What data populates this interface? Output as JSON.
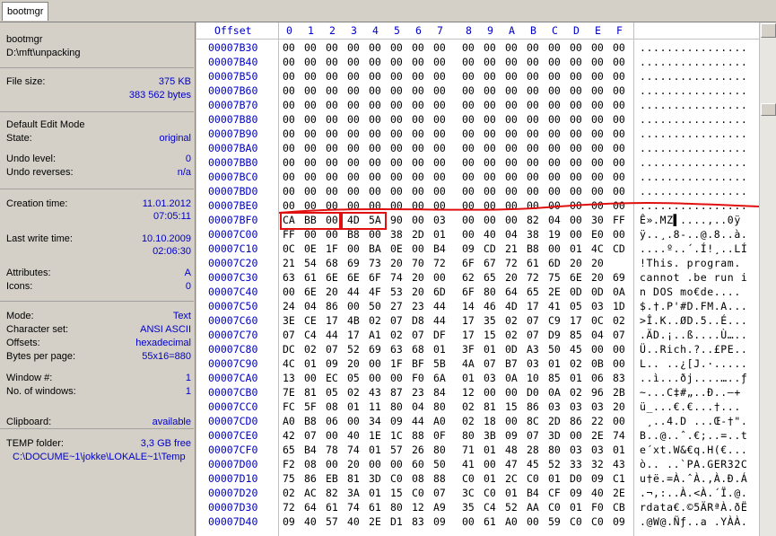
{
  "tab": {
    "label": "bootmgr"
  },
  "side": {
    "file_name": "bootmgr",
    "file_path": "D:\\mft\\unpacking",
    "file_size_label": "File size:",
    "file_size_kb": "375 KB",
    "file_size_bytes": "383 562 bytes",
    "edit_mode": "Default Edit Mode",
    "state_label": "State:",
    "state_value": "original",
    "undo_level_label": "Undo level:",
    "undo_level_value": "0",
    "undo_reverses_label": "Undo reverses:",
    "undo_reverses_value": "n/a",
    "creation_label": "Creation time:",
    "creation_date": "11.01.2012",
    "creation_time": "07:05:11",
    "write_label": "Last write time:",
    "write_date": "10.10.2009",
    "write_time": "02:06:30",
    "attributes_label": "Attributes:",
    "attributes_value": "A",
    "icons_label": "Icons:",
    "icons_value": "0",
    "mode_label": "Mode:",
    "mode_value": "Text",
    "charset_label": "Character set:",
    "charset_value": "ANSI ASCII",
    "offsets_label": "Offsets:",
    "offsets_value": "hexadecimal",
    "bpp_label": "Bytes per page:",
    "bpp_value": "55x16=880",
    "window_label": "Window #:",
    "window_value": "1",
    "nwindows_label": "No. of windows:",
    "nwindows_value": "1",
    "clipboard_label": "Clipboard:",
    "clipboard_value": "available",
    "temp_label": "TEMP folder:",
    "temp_free": "3,3 GB free",
    "temp_path": "C:\\DOCUME~1\\jokke\\LOKALE~1\\Temp"
  },
  "hex": {
    "offset_header": "Offset",
    "columns": [
      "0",
      "1",
      "2",
      "3",
      "4",
      "5",
      "6",
      "7",
      "8",
      "9",
      "A",
      "B",
      "C",
      "D",
      "E",
      "F"
    ],
    "rows": [
      {
        "off": "00007B30",
        "bytes": [
          "00",
          "00",
          "00",
          "00",
          "00",
          "00",
          "00",
          "00",
          "00",
          "00",
          "00",
          "00",
          "00",
          "00",
          "00",
          "00"
        ],
        "ascii": "................"
      },
      {
        "off": "00007B40",
        "bytes": [
          "00",
          "00",
          "00",
          "00",
          "00",
          "00",
          "00",
          "00",
          "00",
          "00",
          "00",
          "00",
          "00",
          "00",
          "00",
          "00"
        ],
        "ascii": "................"
      },
      {
        "off": "00007B50",
        "bytes": [
          "00",
          "00",
          "00",
          "00",
          "00",
          "00",
          "00",
          "00",
          "00",
          "00",
          "00",
          "00",
          "00",
          "00",
          "00",
          "00"
        ],
        "ascii": "................"
      },
      {
        "off": "00007B60",
        "bytes": [
          "00",
          "00",
          "00",
          "00",
          "00",
          "00",
          "00",
          "00",
          "00",
          "00",
          "00",
          "00",
          "00",
          "00",
          "00",
          "00"
        ],
        "ascii": "................"
      },
      {
        "off": "00007B70",
        "bytes": [
          "00",
          "00",
          "00",
          "00",
          "00",
          "00",
          "00",
          "00",
          "00",
          "00",
          "00",
          "00",
          "00",
          "00",
          "00",
          "00"
        ],
        "ascii": "................"
      },
      {
        "off": "00007B80",
        "bytes": [
          "00",
          "00",
          "00",
          "00",
          "00",
          "00",
          "00",
          "00",
          "00",
          "00",
          "00",
          "00",
          "00",
          "00",
          "00",
          "00"
        ],
        "ascii": "................"
      },
      {
        "off": "00007B90",
        "bytes": [
          "00",
          "00",
          "00",
          "00",
          "00",
          "00",
          "00",
          "00",
          "00",
          "00",
          "00",
          "00",
          "00",
          "00",
          "00",
          "00"
        ],
        "ascii": "................"
      },
      {
        "off": "00007BA0",
        "bytes": [
          "00",
          "00",
          "00",
          "00",
          "00",
          "00",
          "00",
          "00",
          "00",
          "00",
          "00",
          "00",
          "00",
          "00",
          "00",
          "00"
        ],
        "ascii": "................"
      },
      {
        "off": "00007BB0",
        "bytes": [
          "00",
          "00",
          "00",
          "00",
          "00",
          "00",
          "00",
          "00",
          "00",
          "00",
          "00",
          "00",
          "00",
          "00",
          "00",
          "00"
        ],
        "ascii": "................"
      },
      {
        "off": "00007BC0",
        "bytes": [
          "00",
          "00",
          "00",
          "00",
          "00",
          "00",
          "00",
          "00",
          "00",
          "00",
          "00",
          "00",
          "00",
          "00",
          "00",
          "00"
        ],
        "ascii": "................"
      },
      {
        "off": "00007BD0",
        "bytes": [
          "00",
          "00",
          "00",
          "00",
          "00",
          "00",
          "00",
          "00",
          "00",
          "00",
          "00",
          "00",
          "00",
          "00",
          "00",
          "00"
        ],
        "ascii": "................"
      },
      {
        "off": "00007BE0",
        "bytes": [
          "00",
          "00",
          "00",
          "00",
          "00",
          "00",
          "00",
          "00",
          "00",
          "00",
          "00",
          "00",
          "00",
          "00",
          "00",
          "00"
        ],
        "ascii": "................"
      },
      {
        "off": "00007BF0",
        "bytes": [
          "CA",
          "BB",
          "00",
          "4D",
          "5A",
          "90",
          "00",
          "03",
          "00",
          "00",
          "00",
          "82",
          "04",
          "00",
          "30",
          "FF"
        ],
        "ascii": "Ê».MZ▌....‚..0ÿ"
      },
      {
        "off": "00007C00",
        "bytes": [
          "FF",
          "00",
          "00",
          "B8",
          "00",
          "38",
          "2D",
          "01",
          "00",
          "40",
          "04",
          "38",
          "19",
          "00",
          "E0",
          "00"
        ],
        "ascii": "ÿ..¸.8-..@.8..à."
      },
      {
        "off": "00007C10",
        "bytes": [
          "0C",
          "0E",
          "1F",
          "00",
          "BA",
          "0E",
          "00",
          "B4",
          "09",
          "CD",
          "21",
          "B8",
          "00",
          "01",
          "4C",
          "CD"
        ],
        "ascii": "....º..´.Í!¸..LÍ"
      },
      {
        "off": "00007C20",
        "bytes": [
          "21",
          "54",
          "68",
          "69",
          "73",
          "20",
          "70",
          "72",
          "6F",
          "67",
          "72",
          "61",
          "6D",
          "20",
          "20"
        ],
        "ascii": "!This. program. "
      },
      {
        "off": "00007C30",
        "bytes": [
          "63",
          "61",
          "6E",
          "6E",
          "6F",
          "74",
          "20",
          "00",
          "62",
          "65",
          "20",
          "72",
          "75",
          "6E",
          "20",
          "69"
        ],
        "ascii": "cannot .be run i"
      },
      {
        "off": "00007C40",
        "bytes": [
          "00",
          "6E",
          "20",
          "44",
          "4F",
          "53",
          "20",
          "6D",
          "6F",
          "80",
          "64",
          "65",
          "2E",
          "0D",
          "0D",
          "0A"
        ],
        "ascii": "n DOS mo€de...."
      },
      {
        "off": "00007C50",
        "bytes": [
          "24",
          "04",
          "86",
          "00",
          "50",
          "27",
          "23",
          "44",
          "14",
          "46",
          "4D",
          "17",
          "41",
          "05",
          "03",
          "1D"
        ],
        "ascii": "$.†.P'#D.FM.A..."
      },
      {
        "off": "00007C60",
        "bytes": [
          "3E",
          "CE",
          "17",
          "4B",
          "02",
          "07",
          "D8",
          "44",
          "17",
          "35",
          "02",
          "07",
          "C9",
          "17",
          "0C",
          "02"
        ],
        "ascii": ">Î.K..ØD.5..É..."
      },
      {
        "off": "00007C70",
        "bytes": [
          "07",
          "C4",
          "44",
          "17",
          "A1",
          "02",
          "07",
          "DF",
          "17",
          "15",
          "02",
          "07",
          "D9",
          "85",
          "04",
          "07"
        ],
        "ascii": ".ÄD.¡..ß....Ù….."
      },
      {
        "off": "00007C80",
        "bytes": [
          "DC",
          "02",
          "07",
          "52",
          "69",
          "63",
          "68",
          "01",
          "3F",
          "01",
          "0D",
          "A3",
          "50",
          "45",
          "00",
          "00"
        ],
        "ascii": "Ü..Rich.?..£PE.."
      },
      {
        "off": "00007C90",
        "bytes": [
          "4C",
          "01",
          "09",
          "20",
          "00",
          "1F",
          "BF",
          "5B",
          "4A",
          "07",
          "B7",
          "03",
          "01",
          "02",
          "0B",
          "00"
        ],
        "ascii": "L.. ..¿[J.·....."
      },
      {
        "off": "00007CA0",
        "bytes": [
          "13",
          "00",
          "EC",
          "05",
          "00",
          "00",
          "F0",
          "6A",
          "01",
          "03",
          "0A",
          "10",
          "85",
          "01",
          "06",
          "83"
        ],
        "ascii": "..ì...ðj....…..ƒ"
      },
      {
        "off": "00007CB0",
        "bytes": [
          "7E",
          "81",
          "05",
          "02",
          "43",
          "87",
          "23",
          "84",
          "12",
          "00",
          "00",
          "D0",
          "0A",
          "02",
          "96",
          "2B"
        ],
        "ascii": "~...C‡#„..Ð..–+"
      },
      {
        "off": "00007CC0",
        "bytes": [
          "FC",
          "5F",
          "08",
          "01",
          "11",
          "80",
          "04",
          "80",
          "02",
          "81",
          "15",
          "86",
          "03",
          "03",
          "03",
          "20"
        ],
        "ascii": "ü_...€.€...†... "
      },
      {
        "off": "00007CD0",
        "bytes": [
          "A0",
          "B8",
          "06",
          "00",
          "34",
          "09",
          "44",
          "A0",
          "02",
          "18",
          "00",
          "8C",
          "2D",
          "86",
          "22",
          "00"
        ],
        "ascii": " ¸..4.D ...Œ-†\"."
      },
      {
        "off": "00007CE0",
        "bytes": [
          "42",
          "07",
          "00",
          "40",
          "1E",
          "1C",
          "88",
          "0F",
          "80",
          "3B",
          "09",
          "07",
          "3D",
          "00",
          "2E",
          "74"
        ],
        "ascii": "B..@..ˆ.€;..=..t"
      },
      {
        "off": "00007CF0",
        "bytes": [
          "65",
          "B4",
          "78",
          "74",
          "01",
          "57",
          "26",
          "80",
          "71",
          "01",
          "48",
          "28",
          "80",
          "03",
          "03",
          "01"
        ],
        "ascii": "e´xt.W&€q.H(€..."
      },
      {
        "off": "00007D00",
        "bytes": [
          "F2",
          "08",
          "00",
          "20",
          "00",
          "00",
          "60",
          "50",
          "41",
          "00",
          "47",
          "45",
          "52",
          "33",
          "32",
          "43"
        ],
        "ascii": "ò.. ..`PA.GER32C"
      },
      {
        "off": "00007D10",
        "bytes": [
          "75",
          "86",
          "EB",
          "81",
          "3D",
          "C0",
          "08",
          "88",
          "C0",
          "01",
          "2C",
          "C0",
          "01",
          "D0",
          "09",
          "C1"
        ],
        "ascii": "u†ë.=À.ˆÀ.,À.Ð.Á"
      },
      {
        "off": "00007D20",
        "bytes": [
          "02",
          "AC",
          "82",
          "3A",
          "01",
          "15",
          "C0",
          "07",
          "3C",
          "C0",
          "01",
          "B4",
          "CF",
          "09",
          "40",
          "2E"
        ],
        "ascii": ".¬‚:..À.<À.´Ï.@."
      },
      {
        "off": "00007D30",
        "bytes": [
          "72",
          "64",
          "61",
          "74",
          "61",
          "80",
          "12",
          "A9",
          "35",
          "C4",
          "52",
          "AA",
          "C0",
          "01",
          "F0",
          "CB"
        ],
        "ascii": "rdata€.©5ÄRªÀ.ðË"
      },
      {
        "off": "00007D40",
        "bytes": [
          "09",
          "40",
          "57",
          "40",
          "2E",
          "D1",
          "83",
          "09",
          "00",
          "61",
          "A0",
          "00",
          "59",
          "C0",
          "C0",
          "09"
        ],
        "ascii": ".@W@.Ñƒ..a .YÀÀ."
      }
    ]
  }
}
